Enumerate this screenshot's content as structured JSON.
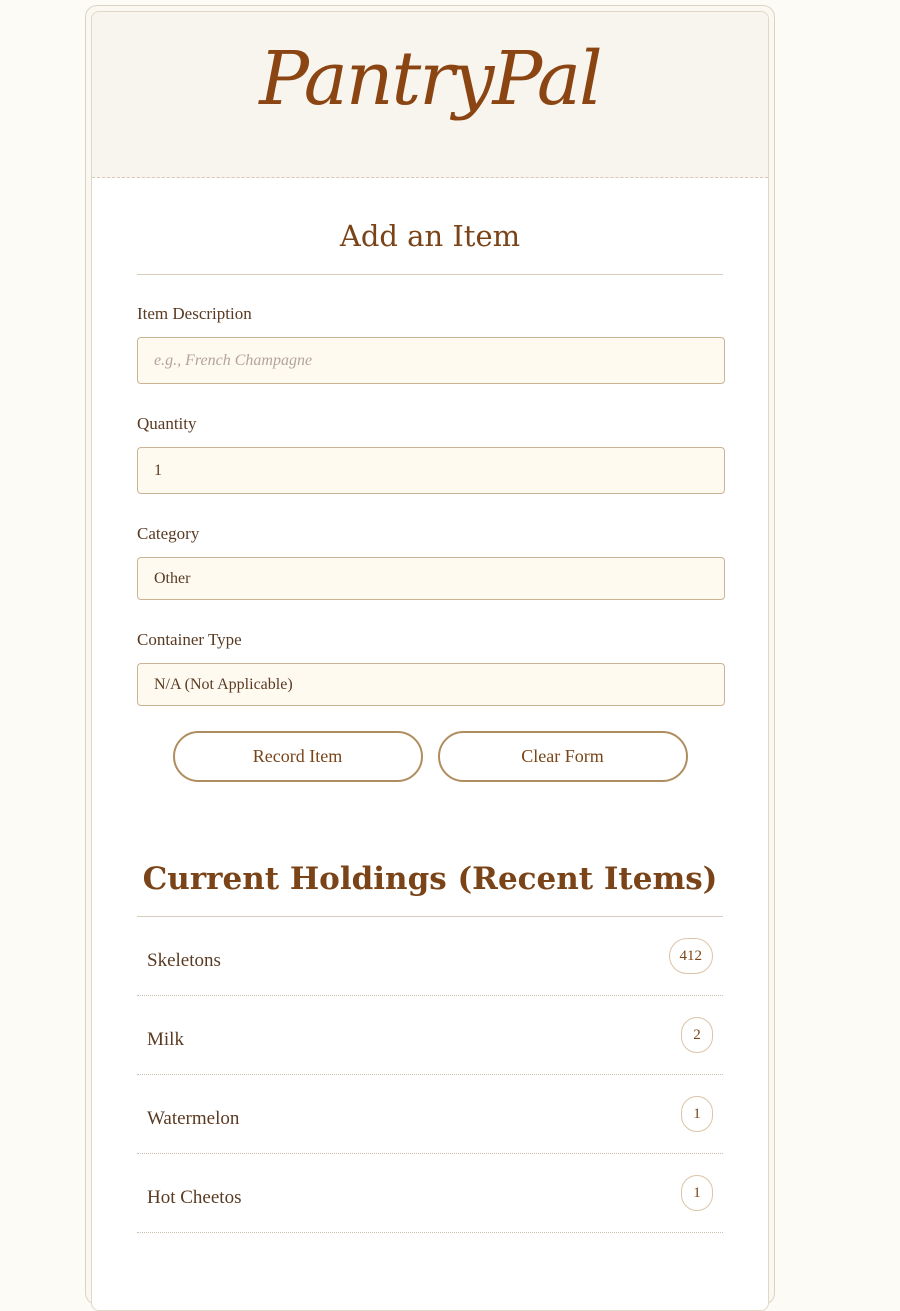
{
  "app": {
    "logo_text": "PantryPal"
  },
  "add_form": {
    "title": "Add an Item",
    "fields": [
      {
        "label": "Item Description",
        "value": "",
        "placeholder": "e.g., French Champagne"
      },
      {
        "label": "Quantity",
        "value": "1",
        "placeholder": ""
      },
      {
        "label": "Category",
        "value": "Other",
        "placeholder": ""
      },
      {
        "label": "Container Type",
        "value": "N/A (Not Applicable)",
        "placeholder": ""
      }
    ],
    "record_button": "Record Item",
    "clear_button": "Clear Form"
  },
  "holdings": {
    "title": "Current Holdings (Recent Items)",
    "items": [
      {
        "name": "Skeletons",
        "count": "412"
      },
      {
        "name": "Milk",
        "count": "2"
      },
      {
        "name": "Watermelon",
        "count": "1"
      },
      {
        "name": "Hot Cheetos",
        "count": "1"
      }
    ]
  },
  "colors": {
    "accent": "#8b4513",
    "button_border": "#b08d5e",
    "input_background": "#fffaf0"
  }
}
